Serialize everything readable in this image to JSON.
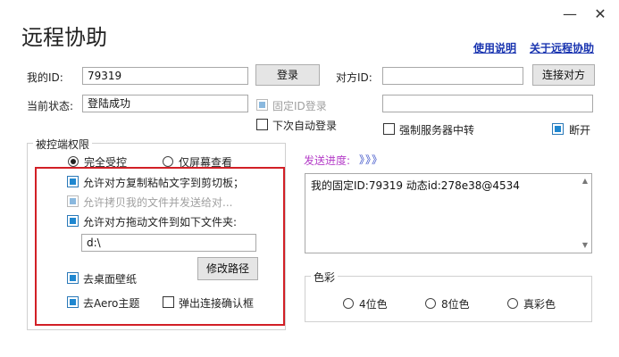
{
  "window": {
    "title": "远程协助",
    "min_glyph": "—",
    "close_glyph": "✕"
  },
  "header_links": {
    "help": "使用说明",
    "about": "关于远程协助"
  },
  "my_id": {
    "label": "我的ID:",
    "value": "79319"
  },
  "status": {
    "label": "当前状态:",
    "value": "登陆成功"
  },
  "login_button": "登录",
  "fixed_id_login": {
    "label": "固定ID登录",
    "checked": true,
    "disabled": true
  },
  "auto_login_next": {
    "label": "下次自动登录",
    "checked": false
  },
  "peer": {
    "label": "对方ID:",
    "value": "",
    "connect_button": "连接对方",
    "extra_value": ""
  },
  "force_relay": {
    "label": "强制服务器中转",
    "checked": false
  },
  "disconnect": {
    "label": "断开",
    "checked": true
  },
  "controlled_permissions": {
    "title": "被控端权限",
    "mode_full": "完全受控",
    "mode_screen_only": "仅屏幕查看",
    "selected_mode": "完全受控",
    "allow_copy_text": {
      "label": "允许对方复制粘帖文字到剪切板；",
      "checked": true
    },
    "allow_copy_files": {
      "label": "允许拷贝我的文件并发送给对...",
      "checked": true,
      "disabled": true
    },
    "allow_drag_files": {
      "label": "允许对方拖动文件到如下文件夹:",
      "checked": true
    },
    "folder_path": "d:\\",
    "change_path_button": "修改路径",
    "remove_wallpaper": {
      "label": "去桌面壁纸",
      "checked": true
    },
    "remove_aero": {
      "label": "去Aero主题",
      "checked": true
    },
    "popup_confirm": {
      "label": "弹出连接确认框",
      "checked": false
    }
  },
  "send_progress": {
    "label": "发送进度:",
    "arrows": "》》》",
    "log_text": "我的固定ID:79319 动态id:278e38@4534"
  },
  "color_depth": {
    "title": "色彩",
    "options": [
      "4位色",
      "8位色",
      "真彩色"
    ],
    "selected": ""
  },
  "colors": {
    "link": "#1a35b0",
    "progress_label": "#b43cc8",
    "highlight_box": "#d21f26",
    "checkbox_fill": "#1f87d0"
  }
}
